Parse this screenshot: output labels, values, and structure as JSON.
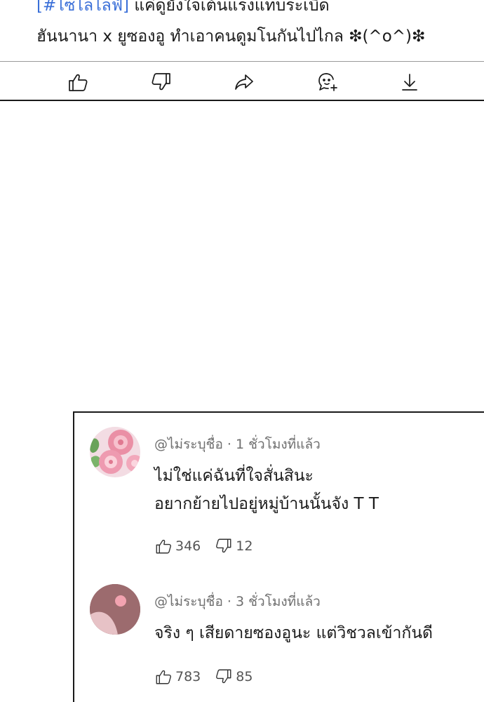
{
  "post": {
    "caption_tag": "[#ไซไลไลฟ์]",
    "caption_line1_rest": " แค่ดูยังใจเต้นแรงแทบระเบิด",
    "caption_line2": "ฮันนานา x ยูซองอู ทำเอาคนดูมโนกันไปไกล ❇(^o^)❇"
  },
  "actions": [
    {
      "name": "like-button",
      "icon": "thumbs-up-icon"
    },
    {
      "name": "dislike-button",
      "icon": "thumbs-down-icon"
    },
    {
      "name": "share-button",
      "icon": "share-arrow-icon"
    },
    {
      "name": "add-sticker-button",
      "icon": "sticker-add-icon"
    },
    {
      "name": "download-button",
      "icon": "download-icon"
    }
  ],
  "comments": [
    {
      "author": "@ไม่ระบุชื่อ",
      "time": "1 ชั่วโมงที่แล้ว",
      "meta": "@ไม่ระบุชื่อ · 1 ชั่วโมงที่แล้ว",
      "lines": [
        "ไม่ใช่แค่ฉันที่ใจสั่นสินะ",
        "อยากย้ายไปอยู่หมู่บ้านนั้นจัง T T"
      ],
      "likes": "346",
      "dislikes": "12",
      "avatar": "flower-avatar"
    },
    {
      "author": "@ไม่ระบุชื่อ",
      "time": "3 ชั่วโมงที่แล้ว",
      "meta": "@ไม่ระบุชื่อ · 3 ชั่วโมงที่แล้ว",
      "lines": [
        "จริง ๆ เสียดายซองอูนะ แต่วิชวลเข้ากันดี"
      ],
      "likes": "783",
      "dislikes": "85",
      "avatar": "default-avatar"
    }
  ],
  "colors": {
    "accent_tag": "#3a6fd8",
    "avatar_bg": "#9c6b6e",
    "avatar_dot": "#f2a3b0"
  }
}
